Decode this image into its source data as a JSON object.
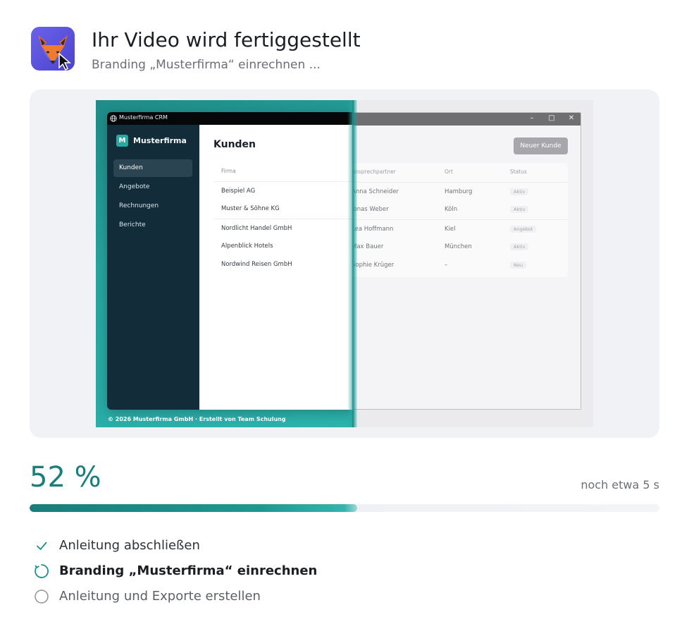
{
  "header": {
    "title": "Ihr Video wird fertiggestellt",
    "subtitle": "Branding „Musterfirma“ einrechnen ...",
    "app_icon": "fox-cursor-icon"
  },
  "preview": {
    "window_title": "Musterfirma CRM",
    "brand_mark": "M",
    "brand_name": "Musterfirma",
    "nav": [
      "Kunden",
      "Angebote",
      "Rechnungen",
      "Berichte"
    ],
    "active_nav": "Kunden",
    "page_title": "Kunden",
    "new_button": "Neuer Kunde",
    "table": {
      "headers": [
        "Firma",
        "Ansprechpartner",
        "Ort",
        "Status"
      ],
      "rows": [
        [
          "Beispiel AG",
          "Anna Schneider",
          "Hamburg",
          "Aktiv"
        ],
        [
          "Muster & Söhne KG",
          "Jonas Weber",
          "Köln",
          "Aktiv"
        ],
        [
          "Nordlicht Handel GmbH",
          "Lea Hoffmann",
          "Kiel",
          "Angebot"
        ],
        [
          "Alpenblick Hotels",
          "Max Bauer",
          "München",
          "Aktiv"
        ],
        [
          "Nordwind Reisen GmbH",
          "Sophie Krüger",
          "–",
          "Neu"
        ]
      ]
    },
    "footer": "© 2026 Musterfirma GmbH  ·  Erstellt von Team Schulung",
    "window_controls": [
      "–",
      "□",
      "✕"
    ],
    "accent_color": "#27a9a3"
  },
  "progress": {
    "percent_label": "52 %",
    "percent": 52,
    "eta": "noch etwa 5 s",
    "color": "#1a7f7c"
  },
  "steps": [
    {
      "label": "Anleitung abschließen",
      "state": "done",
      "icon": "check-icon"
    },
    {
      "label": "Branding „Musterfirma“ einrechnen",
      "state": "current",
      "icon": "spinner-icon"
    },
    {
      "label": "Anleitung und Exporte erstellen",
      "state": "pending",
      "icon": "circle-icon"
    }
  ]
}
